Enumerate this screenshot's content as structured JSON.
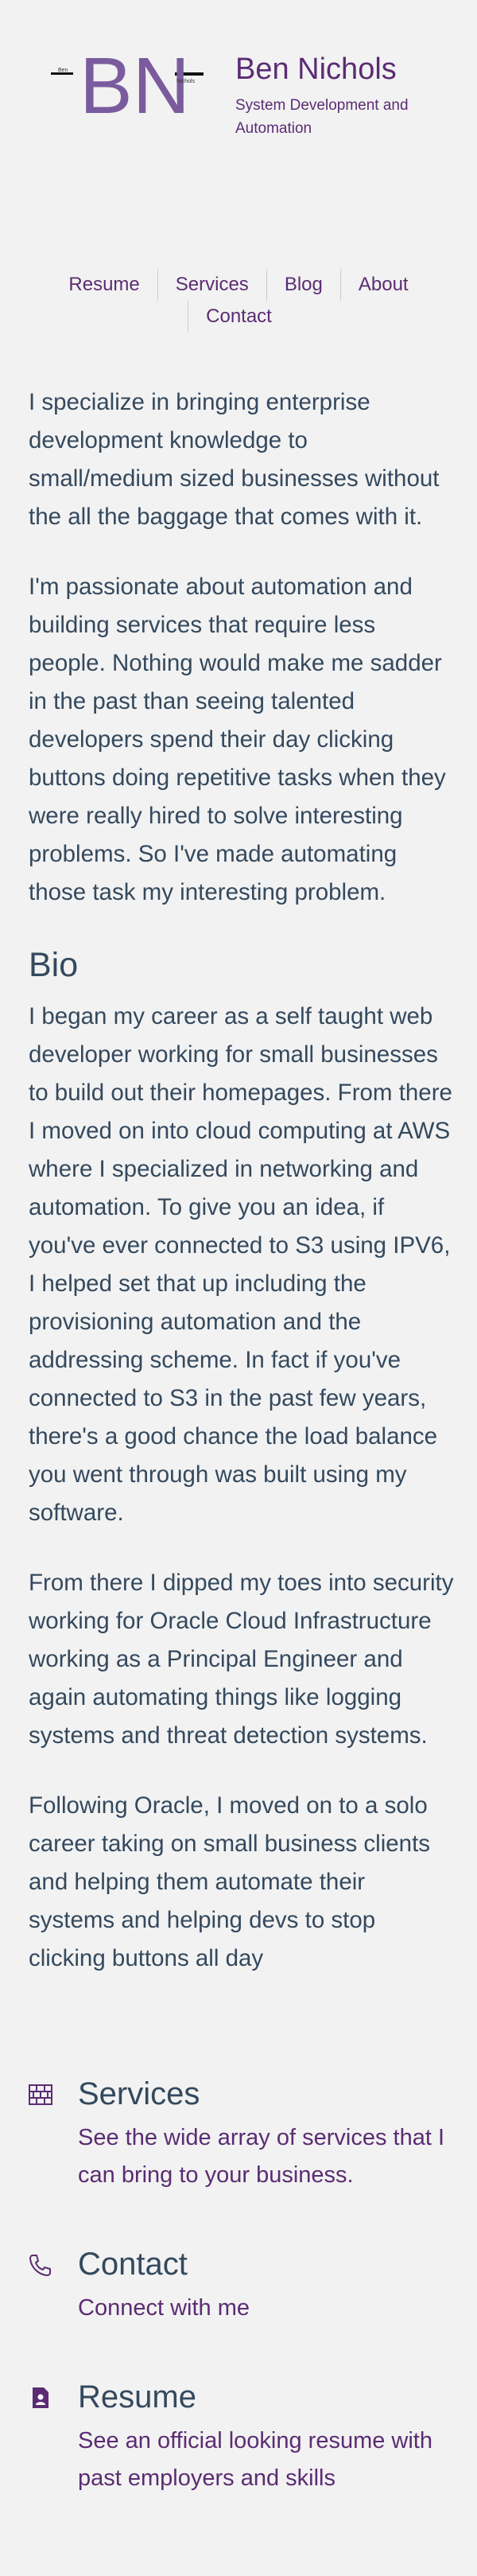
{
  "header": {
    "logo_letters": "BN",
    "logo_small_left": "Ben",
    "logo_small_right": "Nichols",
    "title": "Ben Nichols",
    "subtitle": "System Development and Automation"
  },
  "nav": {
    "items": [
      {
        "label": "Resume"
      },
      {
        "label": "Services"
      },
      {
        "label": "Blog"
      },
      {
        "label": "About"
      },
      {
        "label": "Contact"
      }
    ]
  },
  "intro": {
    "paragraphs": [
      "I specialize in bringing enterprise development knowledge to small/medium sized businesses without the all the baggage that comes with it.",
      "I'm passionate about automation and building services that require less people. Nothing would make me sadder in the past than seeing talented developers spend their day clicking buttons doing repetitive tasks when they were really hired to solve interesting problems. So I've made automating those task my interesting problem."
    ]
  },
  "bio": {
    "heading": "Bio",
    "paragraphs": [
      "I began my career as a self taught web developer working for small businesses to build out their homepages. From there I moved on into cloud computing at AWS where I specialized in networking and automation. To give you an idea, if you've ever connected to S3 using IPV6, I helped set that up including the provisioning automation and the addressing scheme. In fact if you've connected to S3 in the past few years, there's a good chance the load balance you went through was built using my software.",
      "From there I dipped my toes into security working for Oracle Cloud Infrastructure working as a Principal Engineer and again automating things like logging systems and threat detection systems.",
      "Following Oracle, I moved on to a solo career taking on small business clients and helping them automate their systems and helping devs to stop clicking buttons all day"
    ]
  },
  "cards": [
    {
      "icon": "bricks-icon",
      "title": "Services",
      "text": "See the wide array of services that I can bring to your business."
    },
    {
      "icon": "phone-icon",
      "title": "Contact",
      "text": "Connect with me"
    },
    {
      "icon": "document-icon",
      "title": "Resume",
      "text": "See an official looking resume with past employers and skills"
    }
  ],
  "colors": {
    "background": "#f2f2f2",
    "accent": "#5b2c73",
    "text": "#34495e",
    "logo": "#7a5c9e"
  }
}
